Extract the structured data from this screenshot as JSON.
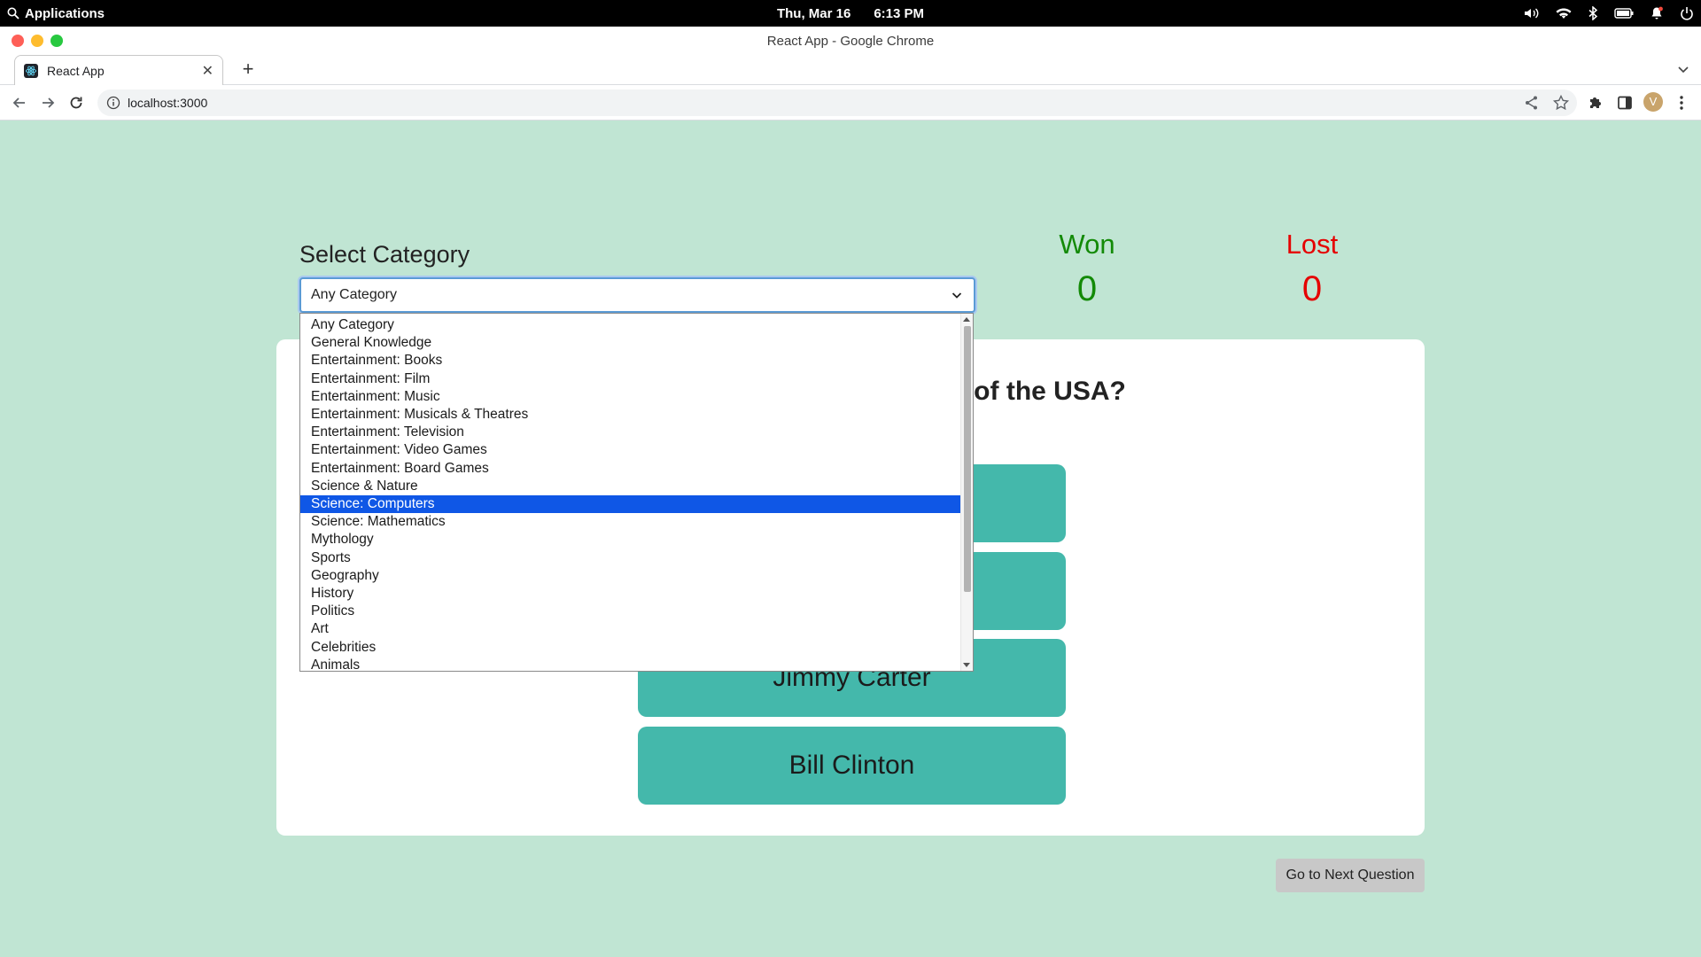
{
  "os": {
    "apps_label": "Applications",
    "date": "Thu, Mar 16",
    "time": "6:13 PM"
  },
  "window": {
    "title": "React App - Google Chrome"
  },
  "browser": {
    "tab_title": "React App",
    "url": "localhost:3000",
    "avatar_initial": "V"
  },
  "page": {
    "select_label": "Select Category",
    "selected_category": "Any Category",
    "won_label": "Won",
    "won_value": "0",
    "lost_label": "Lost",
    "lost_value": "0",
    "question_visible": "of the USA?",
    "answers": [
      "Jimmy Carter",
      "Bill Clinton"
    ],
    "next_button": "Go to Next Question"
  },
  "dropdown": {
    "options": [
      "Any Category",
      "General Knowledge",
      "Entertainment: Books",
      "Entertainment: Film",
      "Entertainment: Music",
      "Entertainment: Musicals & Theatres",
      "Entertainment: Television",
      "Entertainment: Video Games",
      "Entertainment: Board Games",
      "Science & Nature",
      "Science: Computers",
      "Science: Mathematics",
      "Mythology",
      "Sports",
      "Geography",
      "History",
      "Politics",
      "Art",
      "Celebrities",
      "Animals"
    ],
    "highlighted_option": "Science: Computers"
  },
  "colors": {
    "page_bg": "#c0e5d3",
    "answer_bg": "#44b8ab",
    "won": "#138a07",
    "lost": "#e50000",
    "highlight": "#0f57e6"
  }
}
